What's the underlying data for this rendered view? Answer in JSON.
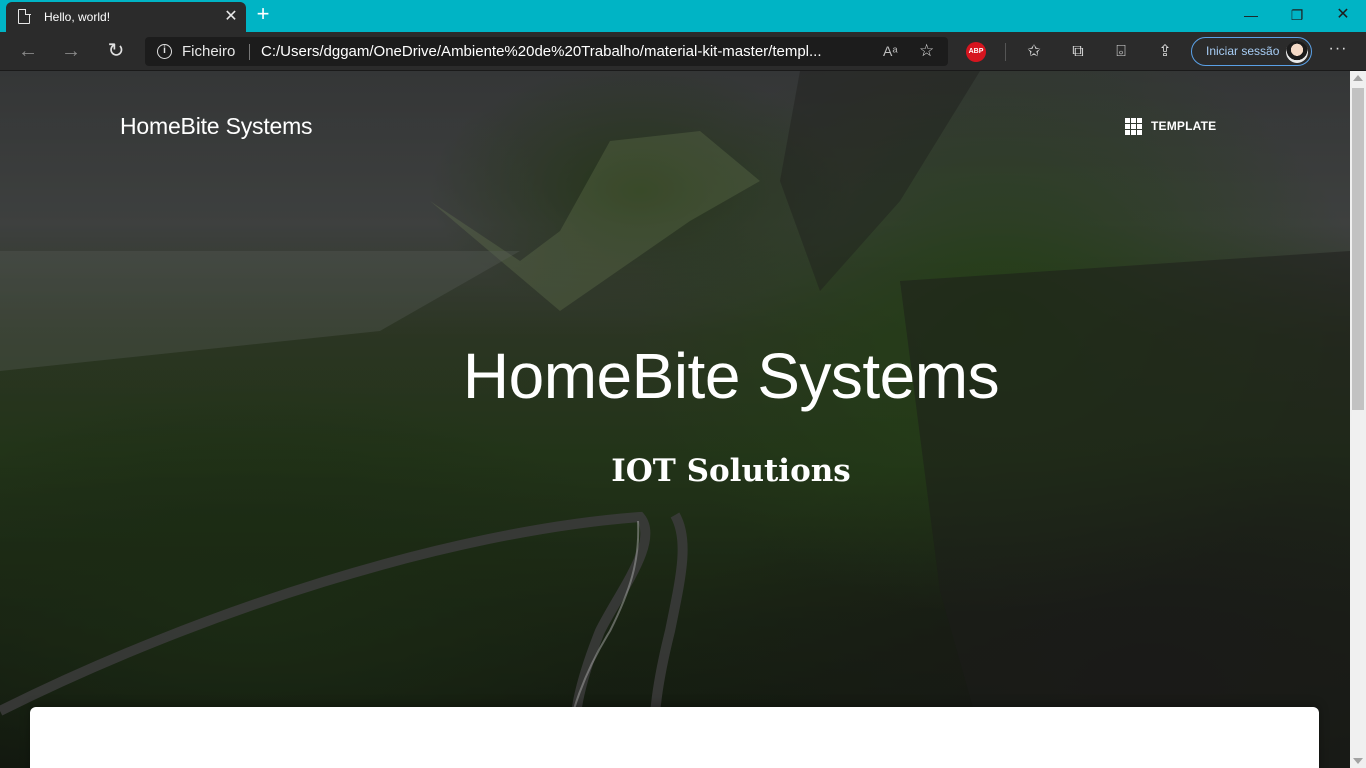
{
  "browser": {
    "tab": {
      "title": "Hello, world!",
      "close": "✕"
    },
    "new_tab": "+",
    "window_controls": {
      "minimize": "—",
      "restore": "❐",
      "close": "✕"
    },
    "nav": {
      "back": "←",
      "forward": "→",
      "refresh": "↻"
    },
    "address": {
      "scheme_label": "Ficheiro",
      "url": "C:/Users/dggam/OneDrive/Ambiente%20de%20Trabalho/material-kit-master/templ..."
    },
    "extensions": {
      "adblock": "ABP"
    },
    "signin_label": "Iniciar sessão",
    "more_menu": "···",
    "accent_color": "#00b4c5"
  },
  "page": {
    "brand": "HomeBite Systems",
    "menu": {
      "template_label": "TEMPLATE"
    },
    "hero": {
      "title": "HomeBite Systems",
      "subtitle": "IOT Solutions"
    }
  },
  "icons": {
    "tab": "page-icon",
    "info": "info-icon",
    "read_aloud": "read-aloud-icon",
    "favorite": "star-icon",
    "favorites": "favorites-icon",
    "collections": "collections-icon",
    "screenshot": "web-capture-icon",
    "share": "share-icon",
    "menu": "apps-grid-icon"
  }
}
